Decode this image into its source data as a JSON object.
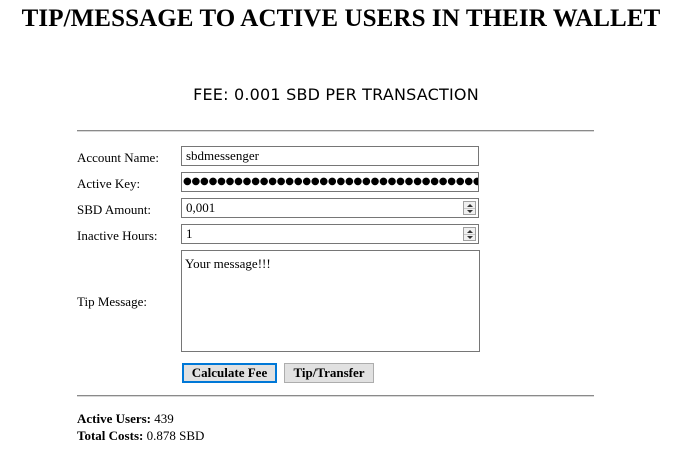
{
  "page": {
    "title": "TIP/MESSAGE TO ACTIVE USERS IN THEIR WALLET",
    "fee_notice": "FEE: 0.001 SBD PER TRANSACTION"
  },
  "form": {
    "account_name": {
      "label": "Account Name:",
      "value": "sbdmessenger"
    },
    "active_key": {
      "label": "Active Key:",
      "value": "●●●●●●●●●●●●●●●●●●●●●●●●●●●●●●●●●●●●●"
    },
    "sbd_amount": {
      "label": "SBD Amount:",
      "value": "0,001"
    },
    "inactive_hours": {
      "label": "Inactive Hours:",
      "value": "1"
    },
    "tip_message": {
      "label": "Tip Message:",
      "value": "Your message!!!"
    }
  },
  "buttons": {
    "calculate_fee": "Calculate Fee",
    "tip_transfer": "Tip/Transfer"
  },
  "results": {
    "active_users_label": "Active Users:",
    "active_users_value": " 439",
    "total_costs_label": "Total Costs:",
    "total_costs_value": " 0.878 SBD"
  },
  "icons": {
    "stepper": "spinner-arrows-icon"
  }
}
